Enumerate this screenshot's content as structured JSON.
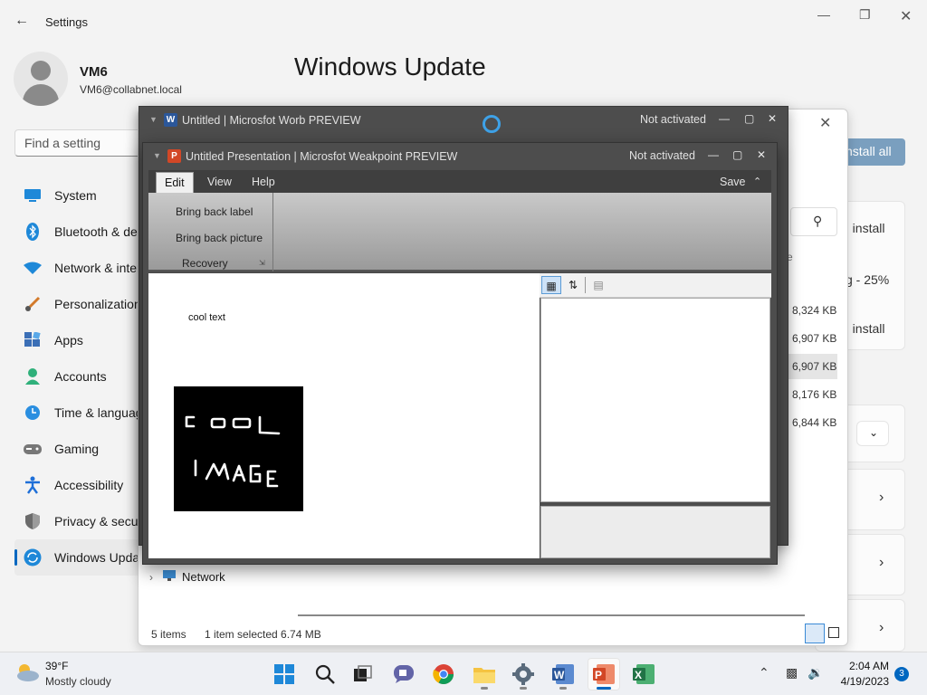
{
  "settings": {
    "window_title": "Settings",
    "user": {
      "name": "VM6",
      "email": "VM6@collabnet.local"
    },
    "page_heading": "Windows Update",
    "search_placeholder": "Find a setting",
    "nav": [
      {
        "label": "System",
        "icon": "system-icon"
      },
      {
        "label": "Bluetooth & devices",
        "icon": "bluetooth-icon"
      },
      {
        "label": "Network & internet",
        "icon": "network-icon"
      },
      {
        "label": "Personalization",
        "icon": "brush-icon"
      },
      {
        "label": "Apps",
        "icon": "apps-icon"
      },
      {
        "label": "Accounts",
        "icon": "accounts-icon"
      },
      {
        "label": "Time & language",
        "icon": "clock-icon"
      },
      {
        "label": "Gaming",
        "icon": "gamepad-icon"
      },
      {
        "label": "Accessibility",
        "icon": "accessibility-icon"
      },
      {
        "label": "Privacy & security",
        "icon": "shield-icon"
      },
      {
        "label": "Windows Update",
        "icon": "update-icon",
        "active": true
      }
    ],
    "install_all": "nstall all",
    "status_install_1": "g install",
    "status_progress": "g - 25%",
    "status_install_2": "g install"
  },
  "explorer": {
    "column_fragment": "e",
    "sizes": [
      "8,324 KB",
      "6,907 KB",
      "6,907 KB",
      "8,176 KB",
      "6,844 KB"
    ],
    "nav_network": "Network",
    "status_items": "5 items",
    "status_selected": "1 item selected  6.74 MB"
  },
  "worb": {
    "title": "Untitled | Microsfot Worb PREVIEW",
    "activation": "Not activated",
    "app_icon_letter": "W",
    "accent": "#2b579a"
  },
  "weakpoint": {
    "title": "Untitled Presentation | Microsfot Weakpoint PREVIEW",
    "activation": "Not activated",
    "app_icon_letter": "P",
    "accent": "#d24726",
    "menu": [
      "Edit",
      "View",
      "Help"
    ],
    "save_label": "Save",
    "ribbon": {
      "bring_back_label": "Bring back label",
      "bring_back_picture": "Bring back picture",
      "group_label": "Recovery"
    },
    "slide_text": "cool text",
    "slide_image_text": [
      "COOL",
      "IMAGE"
    ]
  },
  "taskbar": {
    "weather_temp": "39°F",
    "weather_desc": "Mostly cloudy",
    "time": "2:04 AM",
    "date": "4/19/2023",
    "notifications": "3",
    "apps": [
      "windows-start-icon",
      "search-icon",
      "task-view-icon",
      "teams-chat-icon",
      "chrome-icon",
      "file-explorer-icon",
      "settings-icon",
      "worb-icon",
      "weakpoint-icon",
      "excel-icon"
    ]
  }
}
